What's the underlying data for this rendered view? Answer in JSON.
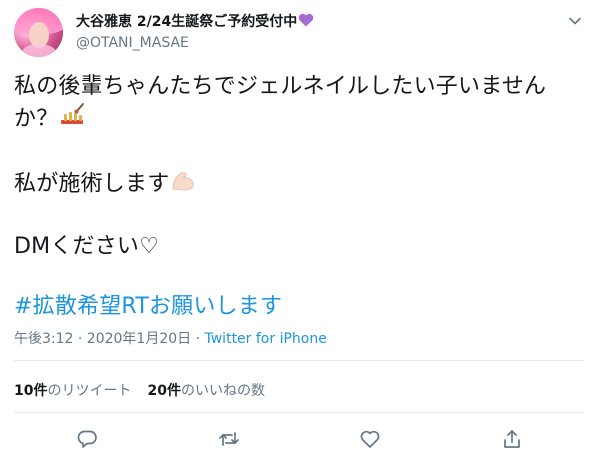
{
  "tweet": {
    "author_name": "大谷雅恵 2/24生誕祭ご予約受付中",
    "author_handle": "@OTANI_MASAE",
    "lines": [
      "私の後輩ちゃんたちでジェルネイルしたい子いません",
      "か？",
      "私が施術します",
      "DMください♡"
    ],
    "hashtag_line": "#拡散希望RTお願いします",
    "timestamp": "午後3:12 · 2020年1月20日 · ",
    "source": "Twitter for iPhone",
    "retweets_count": "10件",
    "retweets_label": "のリツイート",
    "likes_count": "20件",
    "likes_label": "のいいねの数"
  },
  "icons": {
    "name_suffix": "purple-heart-icon",
    "line2_suffix": "nail-polish-icon",
    "line3_suffix": "flexed-biceps-icon",
    "menu": "chevron-down-icon",
    "reply": "reply-icon",
    "retweet": "retweet-icon",
    "like": "heart-outline-icon",
    "share": "share-icon"
  },
  "colors": {
    "link": "#1b95e0",
    "muted": "#657786",
    "text": "#14171a",
    "divider": "#e6ecf0"
  }
}
